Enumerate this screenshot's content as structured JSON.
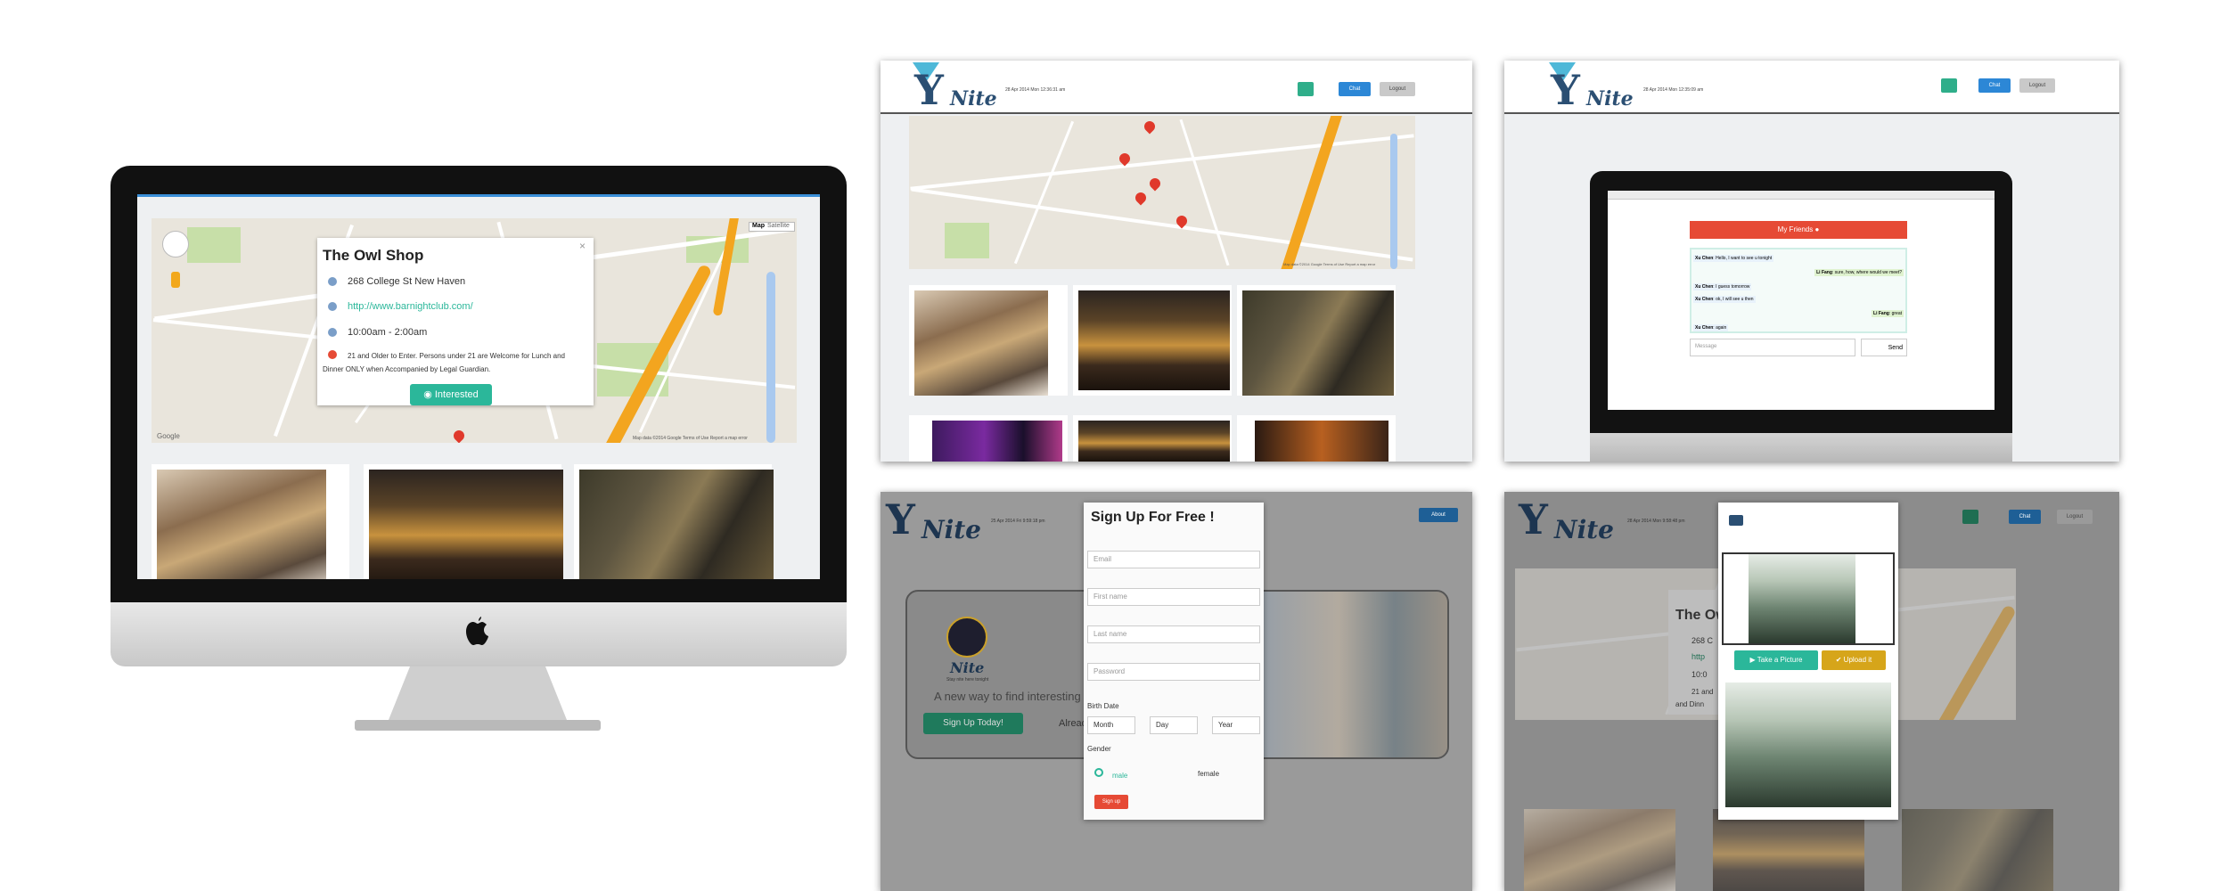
{
  "brand": {
    "logo_letter": "Y",
    "logo_word": "Nite",
    "tagline": "Stay nite here tonight"
  },
  "imac": {
    "map_controls": {
      "map": "Map",
      "satellite": "Satellite"
    },
    "popup": {
      "title": "The Owl Shop",
      "address": "268 College St New Haven",
      "url": "http://www.barnightclub.com/",
      "hours": "10:00am - 2:00am",
      "age_policy": "21 and Older to Enter. Persons under 21 are Welcome for Lunch and Dinner ONLY when Accompanied by Legal Guardian.",
      "interested_label": "Interested",
      "close": "×"
    },
    "map_footer": "Map data ©2014 Google   Terms of Use   Report a map error",
    "map_logo": "Google"
  },
  "screen_map": {
    "datetime": "28 Apr 2014 Mon   12:36:31 am",
    "chat_label": "Chat",
    "logout_label": "Logout",
    "map_footer": "Map data ©2014 Google   Terms of Use   Report a map error"
  },
  "screen_chat": {
    "datetime": "28 Apr 2014 Mon   12:35:09 am",
    "chat_label": "Chat",
    "logout_label": "Logout",
    "friends_header": "My Friends",
    "messages": [
      {
        "from": "Xu Chen",
        "text": "Hello, I want to see u tonight",
        "side": "left"
      },
      {
        "from": "Li Fang",
        "text": "sure, how, where would we meet?",
        "side": "right"
      },
      {
        "from": "Xu Chen",
        "text": "I guess tomorrow",
        "side": "left"
      },
      {
        "from": "Xu Chen",
        "text": "ok, I will see u then",
        "side": "left"
      },
      {
        "from": "Li Fang",
        "text": "great",
        "side": "right"
      },
      {
        "from": "Xu Chen",
        "text": "again",
        "side": "left"
      }
    ],
    "message_placeholder": "Message",
    "send_label": "Send"
  },
  "screen_signup": {
    "datetime": "25 Apr 2014 Fri   9:59:18 pm",
    "about_label": "About",
    "hero_text": "A new way to find interesting thing",
    "hero_already": "Already",
    "signup_today": "Sign Up Today!",
    "modal_title": "Sign Up For Free !",
    "fields": {
      "email": "Email",
      "first": "First name",
      "last": "Last name",
      "password": "Password"
    },
    "birth_label": "Birth Date",
    "birth": {
      "month": "Month",
      "day": "Day",
      "year": "Year"
    },
    "gender_label": "Gender",
    "male": "male",
    "female": "female",
    "submit": "Sign up"
  },
  "screen_camera": {
    "datetime": "28 Apr 2014 Mon   9:58:48 pm",
    "chat_label": "Chat",
    "logout_label": "Logout",
    "take_picture": "Take a Picture",
    "upload": "Upload it",
    "bg_title": "The Owl",
    "bg_addr": "268 C",
    "bg_url": "http",
    "bg_hours": "10:0",
    "bg_age": "21 and",
    "bg_dinner": "and Dinn"
  },
  "colors": {
    "teal": "#2bb79a",
    "blue": "#2c87d6",
    "red": "#e64a35",
    "gold": "#d6a51a",
    "logo": "#2b4f73"
  }
}
